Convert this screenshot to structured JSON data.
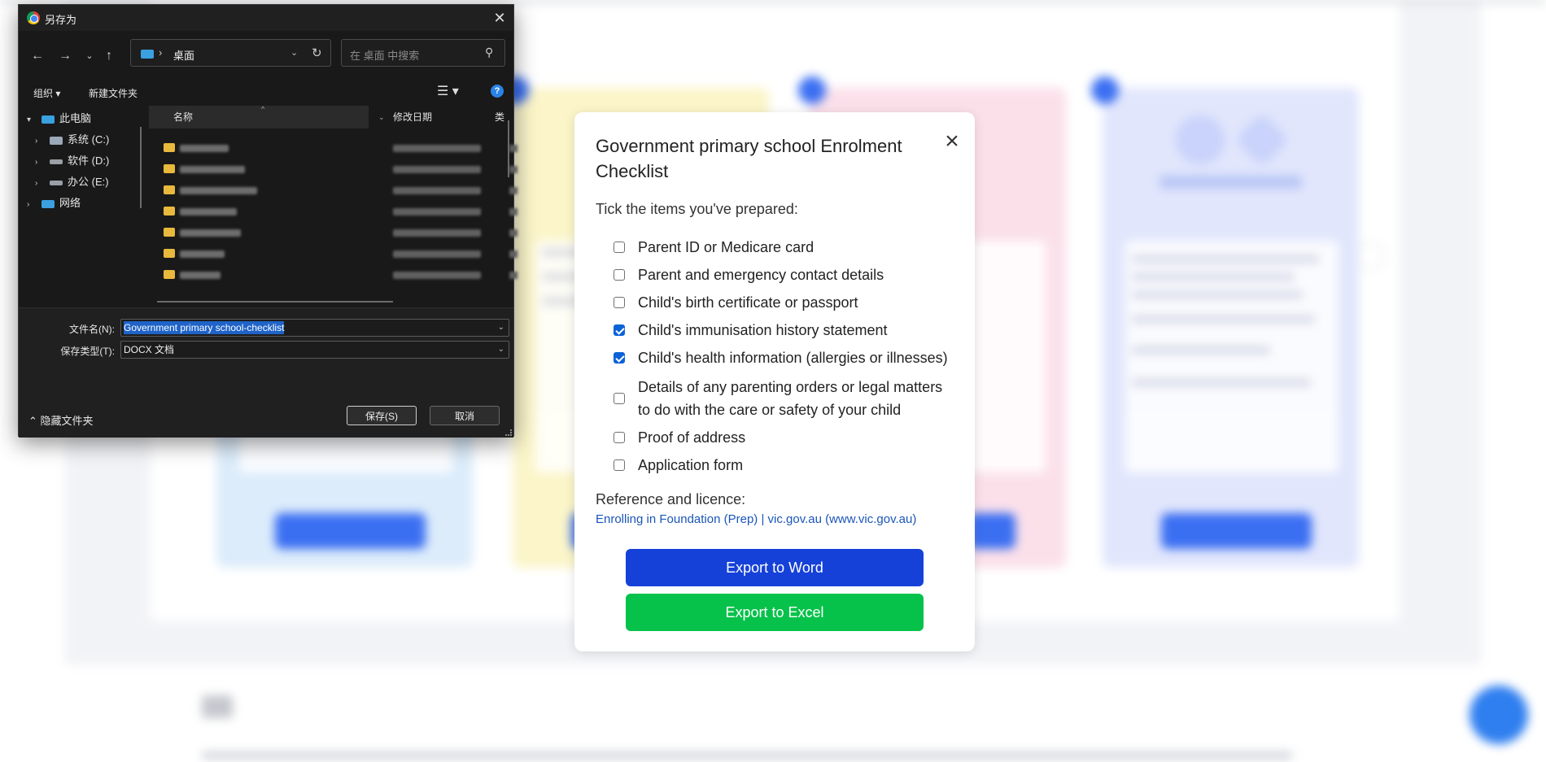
{
  "dialog": {
    "title": "另存为",
    "address_path": "桌面",
    "search_placeholder": "在 桌面 中搜索",
    "toolbar": {
      "organize": "组织",
      "new_folder": "新建文件夹"
    },
    "help_glyph": "?",
    "tree": [
      {
        "label": "此电脑"
      },
      {
        "label": "系统 (C:)"
      },
      {
        "label": "软件 (D:)"
      },
      {
        "label": "办公 (E:)"
      },
      {
        "label": "网络"
      }
    ],
    "columns": {
      "name": "名称",
      "date": "修改日期",
      "type": "类"
    },
    "filename_label": "文件名(N):",
    "filename_value": "Government primary school-checklist",
    "filetype_label": "保存类型(T):",
    "filetype_value": "DOCX 文档",
    "hide_folders": "隐藏文件夹",
    "save_button": "保存(S)",
    "cancel_button": "取消"
  },
  "modal": {
    "title": "Government primary school Enrolment Checklist",
    "subtitle": "Tick the items you've prepared:",
    "items": [
      {
        "label": "Parent ID or Medicare card",
        "checked": false
      },
      {
        "label": "Parent and emergency contact details",
        "checked": false
      },
      {
        "label": "Child's birth certificate or passport",
        "checked": false
      },
      {
        "label": "Child's immunisation history statement",
        "checked": true
      },
      {
        "label": "Child's health information (allergies or illnesses)",
        "checked": true
      },
      {
        "label": "Details of any parenting orders or legal matters to do with the care or safety of your child",
        "checked": false
      },
      {
        "label": "Proof of address",
        "checked": false
      },
      {
        "label": "Application form",
        "checked": false
      }
    ],
    "reference_label": "Reference and licence:",
    "reference_link": "Enrolling in Foundation (Prep) | vic.gov.au (www.vic.gov.au)",
    "export_word": "Export to Word",
    "export_excel": "Export to Excel",
    "close_glyph": "×"
  },
  "colors": {
    "word_button": "#1541d8",
    "excel_button": "#06c24a",
    "link": "#1a55b8",
    "dialog_background": "#191919",
    "selection": "#1f63c8"
  }
}
